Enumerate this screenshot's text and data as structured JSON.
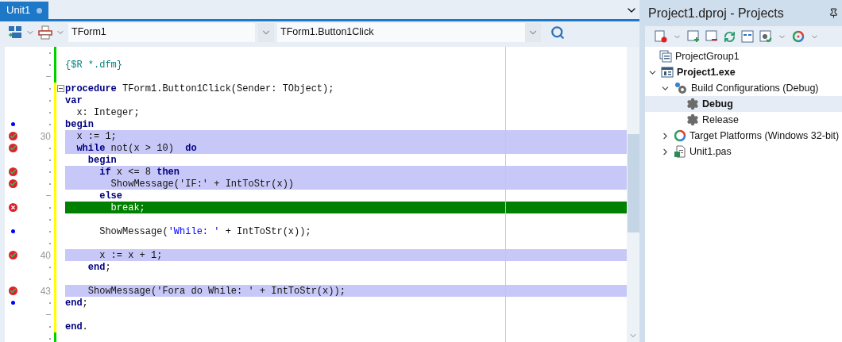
{
  "editor": {
    "tabs": [
      {
        "label": "Unit1",
        "selected": true,
        "modified": true
      }
    ],
    "toolbar": {
      "class_combo": "TForm1",
      "method_combo": "TForm1.Button1Click"
    },
    "lines": [
      {
        "kind": "dot",
        "executable": false,
        "covered": false,
        "changed": false
      },
      {
        "kind": "dot",
        "executable": false,
        "covered": false,
        "changed": false,
        "tokens": [
          {
            "text": "{$R *.dfm}",
            "kind": "comment"
          }
        ]
      },
      {
        "kind": "dash",
        "executable": false,
        "covered": false,
        "changed": false
      },
      {
        "kind": "dot",
        "executable": false,
        "covered": false,
        "changed": true,
        "fold": true,
        "tokens": [
          {
            "text": "procedure",
            "kind": "keyword"
          },
          {
            "text": " TForm1.Button1Click(Sender: TObject);",
            "kind": "plain"
          }
        ]
      },
      {
        "kind": "dot",
        "executable": false,
        "covered": false,
        "changed": true,
        "tokens": [
          {
            "text": "var",
            "kind": "keyword"
          }
        ]
      },
      {
        "kind": "dot",
        "executable": false,
        "covered": false,
        "changed": true,
        "tokens": [
          {
            "text": "  x: Integer;",
            "kind": "plain"
          }
        ]
      },
      {
        "kind": "dot",
        "executable": true,
        "covered": false,
        "changed": true,
        "tokens": [
          {
            "text": "begin",
            "kind": "keyword"
          }
        ]
      },
      {
        "kind": "number",
        "line_number": "30",
        "breakpoint": {
          "valid": true
        },
        "covered": true,
        "changed": true,
        "tokens": [
          {
            "text": "  x := 1;",
            "kind": "plain"
          }
        ]
      },
      {
        "kind": "dot",
        "breakpoint": {
          "valid": true
        },
        "covered": true,
        "changed": true,
        "tokens": [
          {
            "text": "  while",
            "kind": "keyword"
          },
          {
            "text": " not(x > 10)  ",
            "kind": "plain"
          },
          {
            "text": "do",
            "kind": "keyword"
          }
        ]
      },
      {
        "kind": "dot",
        "executable": false,
        "covered": false,
        "changed": true,
        "tokens": [
          {
            "text": "    begin",
            "kind": "keyword"
          }
        ]
      },
      {
        "kind": "dot",
        "breakpoint": {
          "valid": true
        },
        "covered": true,
        "changed": true,
        "tokens": [
          {
            "text": "      if",
            "kind": "keyword"
          },
          {
            "text": " x <= 8 ",
            "kind": "plain"
          },
          {
            "text": "then",
            "kind": "keyword"
          }
        ]
      },
      {
        "kind": "dot",
        "breakpoint": {
          "valid": true
        },
        "covered": true,
        "changed": true,
        "tokens": [
          {
            "text": "        ShowMessage('IF:' + IntToStr(x))",
            "kind": "plain"
          }
        ]
      },
      {
        "kind": "dash",
        "executable": false,
        "covered": false,
        "changed": true,
        "tokens": [
          {
            "text": "      else",
            "kind": "keyword"
          }
        ]
      },
      {
        "kind": "dot",
        "breakpoint": {
          "valid": false
        },
        "current": true,
        "changed": true,
        "tokens": [
          {
            "text": "        break;",
            "kind": "plain"
          }
        ]
      },
      {
        "kind": "dot",
        "executable": false,
        "covered": false,
        "changed": true
      },
      {
        "kind": "dot",
        "executable": true,
        "covered": false,
        "changed": true,
        "tokens": [
          {
            "text": "      ShowMessage(",
            "kind": "plain"
          },
          {
            "text": "'While: '",
            "kind": "string"
          },
          {
            "text": " + IntToStr(x));",
            "kind": "plain"
          }
        ]
      },
      {
        "kind": "dot",
        "executable": false,
        "covered": false,
        "changed": true
      },
      {
        "kind": "number",
        "line_number": "40",
        "breakpoint": {
          "valid": true
        },
        "covered": true,
        "changed": true,
        "tokens": [
          {
            "text": "      x := x + 1;",
            "kind": "plain"
          }
        ]
      },
      {
        "kind": "dot",
        "executable": false,
        "covered": false,
        "changed": true,
        "tokens": [
          {
            "text": "    end",
            "kind": "keyword"
          },
          {
            "text": ";",
            "kind": "plain"
          }
        ]
      },
      {
        "kind": "dot",
        "executable": false,
        "covered": false,
        "changed": true
      },
      {
        "kind": "number",
        "line_number": "43",
        "breakpoint": {
          "valid": true
        },
        "covered": true,
        "changed": true,
        "tokens": [
          {
            "text": "    ShowMessage('Fora do While: ' + IntToStr(x));",
            "kind": "plain"
          }
        ]
      },
      {
        "kind": "dot",
        "executable": true,
        "covered": false,
        "changed": true,
        "tokens": [
          {
            "text": "end",
            "kind": "keyword"
          },
          {
            "text": ";",
            "kind": "plain"
          }
        ]
      },
      {
        "kind": "dash",
        "executable": false,
        "covered": false,
        "changed": true
      },
      {
        "kind": "dot",
        "executable": false,
        "covered": false,
        "changed": true,
        "tokens": [
          {
            "text": "end",
            "kind": "keyword"
          },
          {
            "text": ".",
            "kind": "plain"
          }
        ]
      },
      {
        "kind": "dot",
        "executable": false,
        "covered": false,
        "changed": false
      }
    ]
  },
  "projects": {
    "title": "Project1.dproj - Projects",
    "tree": [
      {
        "label": "ProjectGroup1",
        "kind": "group",
        "active": false,
        "selected": false,
        "children": [
          {
            "label": "Project1.exe",
            "kind": "project",
            "active": true,
            "selected": false,
            "expanded": true,
            "children": [
              {
                "label": "Build Configurations (Debug)",
                "kind": "configs",
                "active": false,
                "selected": false,
                "expanded": true,
                "children": [
                  {
                    "label": "Debug",
                    "kind": "config",
                    "active": true,
                    "selected": true
                  },
                  {
                    "label": "Release",
                    "kind": "config",
                    "active": false,
                    "selected": false
                  }
                ]
              },
              {
                "label": "Target Platforms (Windows 32-bit)",
                "kind": "platforms",
                "active": false,
                "selected": false,
                "expanded": false
              },
              {
                "label": "Unit1.pas",
                "kind": "unit",
                "active": false,
                "selected": false,
                "expanded": false
              }
            ]
          }
        ]
      }
    ]
  }
}
